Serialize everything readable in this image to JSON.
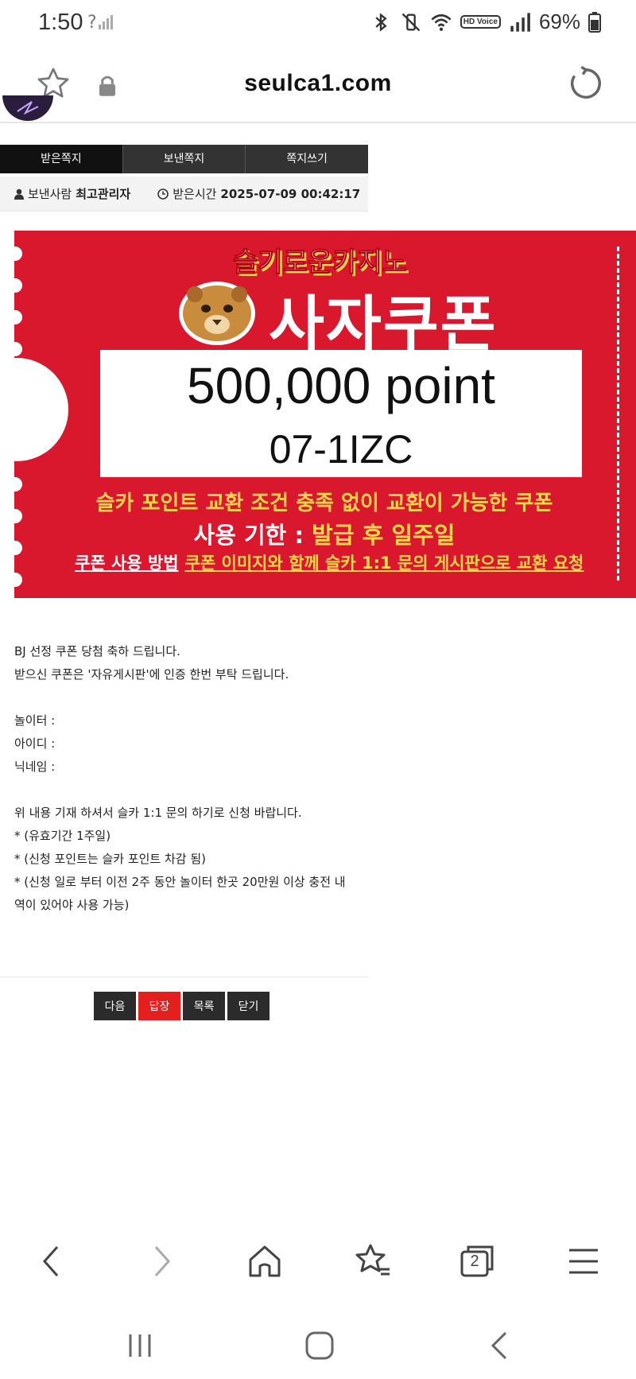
{
  "status_bar": {
    "time": "1:50",
    "network_glyph": "?",
    "battery": "69%",
    "hd_voice": "HD Voice"
  },
  "browser": {
    "url": "seulca1.com"
  },
  "mailbox_tabs": [
    {
      "label": "받은쪽지"
    },
    {
      "label": "보낸쪽지"
    },
    {
      "label": "쪽지쓰기"
    }
  ],
  "message_meta": {
    "sender_label": "보낸사람",
    "sender_name": "최고관리자",
    "received_label": "받은시간",
    "received_time": "2025-07-09 00:42:17"
  },
  "coupon": {
    "brand": "슬기로운카지노",
    "title": "사자쿠폰",
    "amount": "500,000 point",
    "code": "07-1IZC",
    "line1": "슬카 포인트 교환 조건 충족 없이 교환이 가능한 쿠폰",
    "deadline_label": "사용 기한 : ",
    "deadline_value": "발급 후 일주일",
    "usage_label": "쿠폰 사용 방법",
    "usage_text": "쿠폰 이미지와 함께 슬카 1:1 문의 게시판으로 교환 요청"
  },
  "message_body": [
    "BJ 선정 쿠폰 당첨 축하 드립니다.",
    "받으신 쿠폰은 '자유게시판'에 인증 한번 부탁 드립니다.",
    "",
    "놀이터 :",
    "아이디 :",
    "닉네임 :",
    "",
    "위 내용 기재 하셔서 슬카 1:1 문의 하기로 신청 바랍니다.",
    "* (유효기간 1주일)",
    "* (신청 포인트는 슬카 포인트 차감 됨)",
    "* (신청 일로 부터 이전 2주 동안 놀이터 한곳 20만원 이상 충전 내",
    "역이 있어야 사용 가능)"
  ],
  "actions": {
    "next": "다음",
    "reply": "답장",
    "list": "목록",
    "close": "닫기"
  },
  "bottom_nav": {
    "tab_count": "2"
  },
  "colors": {
    "coupon_red": "#d9182e",
    "coupon_yellow": "#ffd84a",
    "reply_red": "#e3201e",
    "tab_dark": "#333333"
  }
}
